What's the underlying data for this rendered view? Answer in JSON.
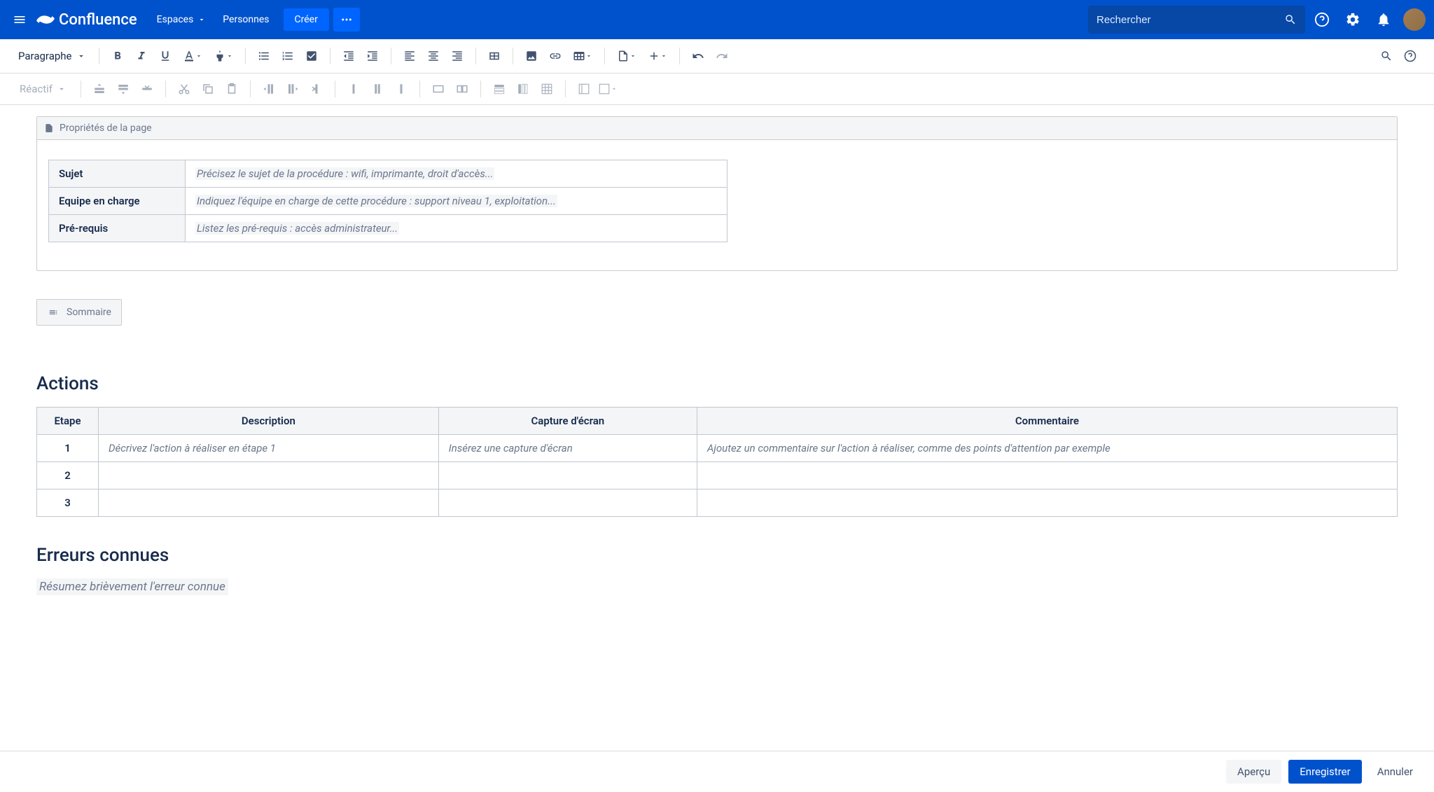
{
  "nav": {
    "logo": "Confluence",
    "spaces": "Espaces",
    "people": "Personnes",
    "create": "Créer",
    "search_placeholder": "Rechercher"
  },
  "toolbar": {
    "format": "Paragraphe",
    "reactive": "Réactif"
  },
  "page_props": {
    "header": "Propriétés de la page",
    "rows": [
      {
        "label": "Sujet",
        "placeholder": "Précisez le sujet de la procédure : wifi, imprimante, droit d'accès..."
      },
      {
        "label": "Equipe en charge",
        "placeholder": "Indiquez l'équipe en charge de cette procédure : support niveau 1, exploitation..."
      },
      {
        "label": "Pré-requis",
        "placeholder": "Listez les pré-requis : accès administrateur..."
      }
    ]
  },
  "sommaire": "Sommaire",
  "actions": {
    "heading": "Actions",
    "headers": [
      "Etape",
      "Description",
      "Capture d'écran",
      "Commentaire"
    ],
    "rows": [
      {
        "step": "1",
        "desc": "Décrivez l'action à réaliser en étape 1",
        "capture": "Insérez une capture d'écran",
        "comment": "Ajoutez un commentaire sur l'action à réaliser, comme des points d'attention par exemple"
      },
      {
        "step": "2",
        "desc": "",
        "capture": "",
        "comment": ""
      },
      {
        "step": "3",
        "desc": "",
        "capture": "",
        "comment": ""
      }
    ]
  },
  "errors": {
    "heading": "Erreurs connues",
    "summary": "Résumez brièvement l'erreur connue"
  },
  "footer": {
    "preview": "Aperçu",
    "save": "Enregistrer",
    "cancel": "Annuler"
  }
}
